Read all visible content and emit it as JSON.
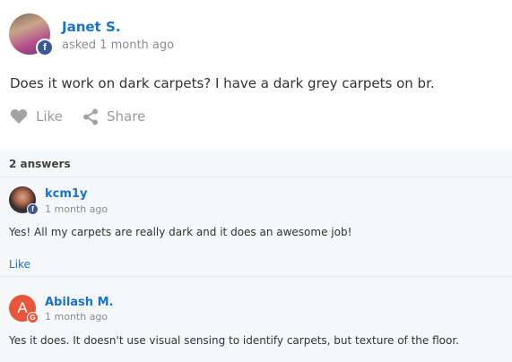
{
  "question": {
    "author": "Janet S.",
    "time": "asked 1 month ago",
    "text": "Does it work on dark carpets? I have a dark grey carpets on br.",
    "like_label": "Like",
    "share_label": "Share",
    "avatar_badge": "f"
  },
  "answers_section": {
    "count_label": "2 answers",
    "answers": [
      {
        "author": "kcm1y",
        "time": "1 month ago",
        "text": "Yes! All my carpets are really dark and it does an awesome job!",
        "like_label": "Like",
        "avatar_badge": "f"
      },
      {
        "author": "Abilash M.",
        "time": "1 month ago",
        "text": "Yes it does. It doesn't use visual sensing to identify carpets, but texture of the floor.",
        "avatar_initial": "A",
        "avatar_badge": "G"
      }
    ]
  },
  "colors": {
    "link_blue": "#1a73c9",
    "muted_gray": "#8c8c8c",
    "facebook_blue": "#3b5998",
    "google_red": "#e9553a",
    "answers_bg": "#f5f7f8"
  },
  "icons": {
    "like": "heart-icon",
    "share": "share-icon",
    "facebook": "facebook-badge-icon",
    "google": "google-badge-icon"
  }
}
